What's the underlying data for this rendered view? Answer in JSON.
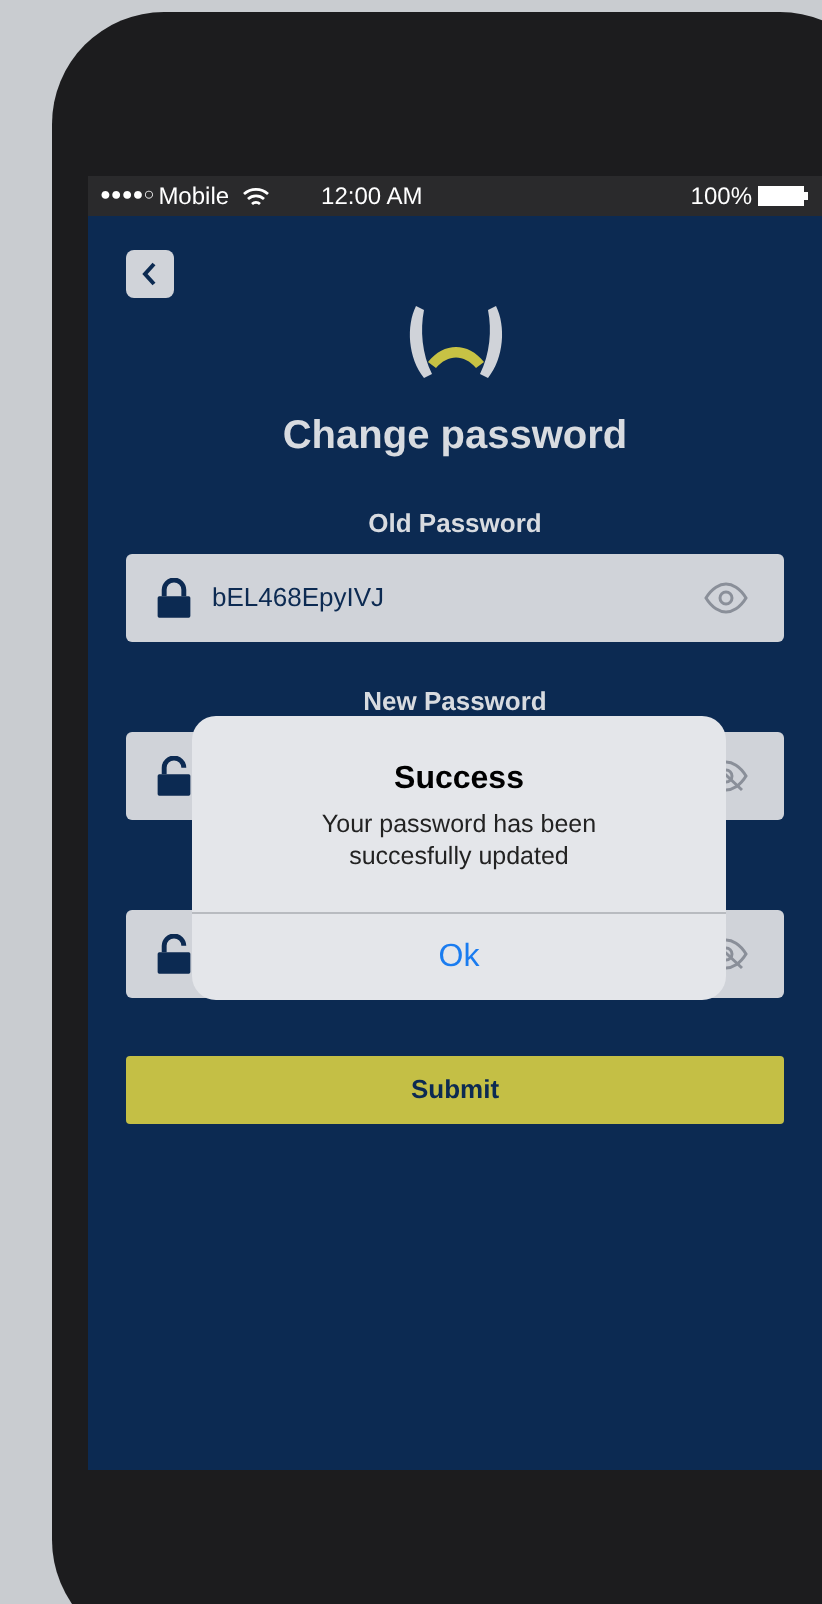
{
  "status_bar": {
    "signal_bars": "●●●●○",
    "carrier": "Mobile",
    "time": "12:00 AM",
    "battery": "100%"
  },
  "title": "Change password",
  "fields": [
    {
      "label": "Old Password",
      "value": "bEL468EpyIVJ",
      "locked": true,
      "masked": false
    },
    {
      "label": "New Password",
      "locked": false,
      "masked": true
    },
    {
      "locked": false,
      "masked": true
    }
  ],
  "submit": "Submit",
  "alert": {
    "title": "Success",
    "message": "Your password has been succesfully updated",
    "button": "Ok"
  }
}
